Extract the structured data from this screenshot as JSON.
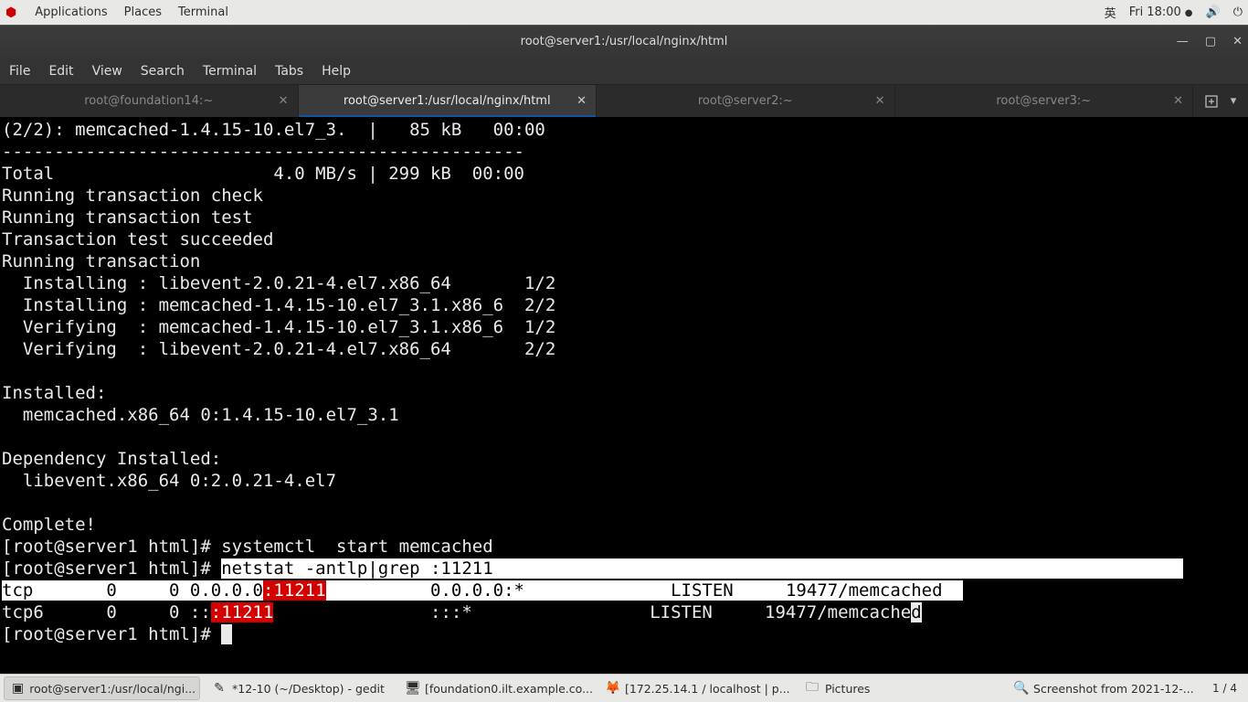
{
  "gnome_panel": {
    "apps": "Applications",
    "places": "Places",
    "terminal": "Terminal",
    "input": "英",
    "clock": "Fri 18:00"
  },
  "window": {
    "title": "root@server1:/usr/local/nginx/html"
  },
  "menubar": {
    "file": "File",
    "edit": "Edit",
    "view": "View",
    "search": "Search",
    "terminal": "Terminal",
    "tabs": "Tabs",
    "help": "Help"
  },
  "tabs": [
    {
      "label": "root@foundation14:~",
      "active": false
    },
    {
      "label": "root@server1:/usr/local/nginx/html",
      "active": true
    },
    {
      "label": "root@server2:~",
      "active": false
    },
    {
      "label": "root@server3:~",
      "active": false
    }
  ],
  "terminal_lines": {
    "l00": "(2/2): memcached-1.4.15-10.el7_3.  |   85 kB   00:00",
    "l01": "--------------------------------------------------",
    "l02": "Total                     4.0 MB/s | 299 kB  00:00",
    "l03": "Running transaction check",
    "l04": "Running transaction test",
    "l05": "Transaction test succeeded",
    "l06": "Running transaction",
    "l07": "  Installing : libevent-2.0.21-4.el7.x86_64       1/2",
    "l08": "  Installing : memcached-1.4.15-10.el7_3.1.x86_6  2/2",
    "l09": "  Verifying  : memcached-1.4.15-10.el7_3.1.x86_6  1/2",
    "l10": "  Verifying  : libevent-2.0.21-4.el7.x86_64       2/2",
    "l11": "",
    "l12": "Installed:",
    "l13": "  memcached.x86_64 0:1.4.15-10.el7_3.1",
    "l14": "",
    "l15": "Dependency Installed:",
    "l16": "  libevent.x86_64 0:2.0.21-4.el7",
    "l17": "",
    "l18": "Complete!",
    "l19": "[root@server1 html]# systemctl  start memcached",
    "l20_a": "[root@server1 html]# ",
    "l20_b": "netstat -antlp|grep :11211                                                                  ",
    "l21_a": "tcp       0     0 0.0.0.0",
    "l21_b": ":11211",
    "l21_c": "          0.0.0.0:*              LISTEN     19477/memcached  ",
    "l22_a": "tcp6      0     0 ::",
    "l22_b": ":11211",
    "l22_c": "               :::*                 LISTEN     19477/memcache",
    "l22_d": "d",
    "l23": "[root@server1 html]# "
  },
  "taskbar": {
    "items": [
      {
        "label": "root@server1:/usr/local/ngi...",
        "icon": "▣",
        "active": true
      },
      {
        "label": "*12-10 (~/Desktop) - gedit",
        "icon": "✎",
        "active": false
      },
      {
        "label": "[foundation0.ilt.example.co...",
        "icon": "🖥",
        "active": false
      },
      {
        "label": "[172.25.14.1 / localhost | p...",
        "icon": "🦊",
        "active": false
      },
      {
        "label": "Pictures",
        "icon": "🗀",
        "active": false
      },
      {
        "label": "Screenshot from 2021-12-...",
        "icon": "🔍",
        "active": false
      }
    ],
    "workspace": "1 / 4"
  }
}
